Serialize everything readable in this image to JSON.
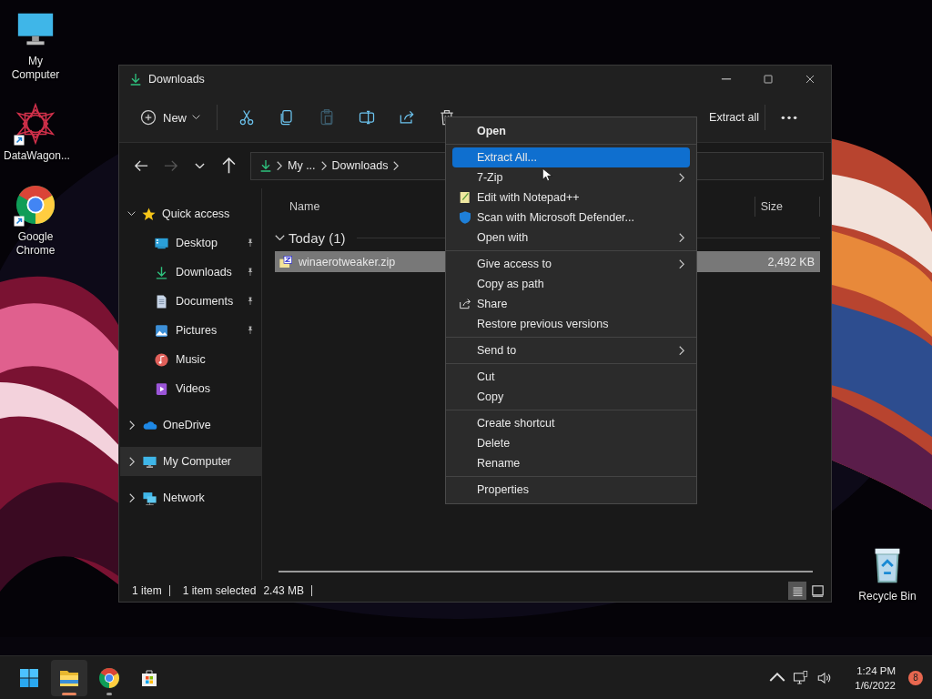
{
  "desktop": {
    "icons": [
      {
        "label": "My Computer",
        "kind": "monitor",
        "shortcut": false
      },
      {
        "label": "DataWagon...",
        "kind": "mandala",
        "shortcut": true
      },
      {
        "label": "Google Chrome",
        "kind": "chrome",
        "shortcut": true
      }
    ],
    "corner_icon": {
      "label": "Recycle Bin",
      "kind": "bin",
      "shortcut": false
    }
  },
  "window": {
    "title": "Downloads",
    "toolbar": {
      "new_label": "New",
      "actions": [
        {
          "kind": "cut",
          "disabled": false
        },
        {
          "kind": "copy",
          "disabled": false
        },
        {
          "kind": "paste",
          "disabled": true
        },
        {
          "kind": "rename",
          "disabled": false
        },
        {
          "kind": "share",
          "disabled": false
        },
        {
          "kind": "delete",
          "disabled": false
        }
      ],
      "extract_label": "Extract all"
    },
    "nav": [
      {
        "kind": "back",
        "disabled": false
      },
      {
        "kind": "forward",
        "disabled": true
      },
      {
        "kind": "recent",
        "disabled": false
      },
      {
        "kind": "up",
        "disabled": false
      }
    ],
    "address": [
      "My ...",
      "Downloads"
    ],
    "sidebar": [
      {
        "label": "Quick access",
        "kind": "star",
        "expanded": true,
        "selected": false,
        "children": [
          {
            "label": "Desktop",
            "kind": "desktop",
            "pinned": true,
            "selected": false
          },
          {
            "label": "Downloads",
            "kind": "download",
            "pinned": true,
            "selected": false
          },
          {
            "label": "Documents",
            "kind": "documents",
            "pinned": true,
            "selected": false
          },
          {
            "label": "Pictures",
            "kind": "pictures",
            "pinned": true,
            "selected": false
          },
          {
            "label": "Music",
            "kind": "music",
            "pinned": false,
            "selected": false
          },
          {
            "label": "Videos",
            "kind": "videos",
            "pinned": false,
            "selected": false
          }
        ]
      },
      {
        "label": "OneDrive",
        "kind": "cloud",
        "expanded": false,
        "selected": false
      },
      {
        "label": "My Computer",
        "kind": "computer",
        "expanded": false,
        "selected": true
      },
      {
        "label": "Network",
        "kind": "network",
        "expanded": false,
        "selected": false
      }
    ],
    "columns": [
      "Name",
      "Size"
    ],
    "group": {
      "label": "Today (1)",
      "expanded": true
    },
    "files": [
      {
        "name": "winaerotweaker.zip",
        "size": "2,492 KB",
        "selected": true
      }
    ],
    "status": [
      {
        "text": "1 item",
        "divider": true
      },
      {
        "text": "1 item selected",
        "divider": false
      },
      {
        "text": "2.43 MB",
        "divider": true
      }
    ],
    "views": [
      {
        "kind": "details",
        "selected": true
      },
      {
        "kind": "tiles",
        "selected": false
      }
    ]
  },
  "context_menu": {
    "groups": [
      [
        {
          "label": "Open",
          "default": true,
          "selected": false,
          "submenu": false
        }
      ],
      [
        {
          "label": "Extract All...",
          "default": false,
          "selected": true,
          "submenu": false
        },
        {
          "label": "7-Zip",
          "default": false,
          "selected": false,
          "submenu": true
        },
        {
          "label": "Edit with Notepad++",
          "default": false,
          "selected": false,
          "submenu": false,
          "kind": "notepad"
        },
        {
          "label": "Scan with Microsoft Defender...",
          "default": false,
          "selected": false,
          "submenu": false,
          "kind": "shield"
        },
        {
          "label": "Open with",
          "default": false,
          "selected": false,
          "submenu": true
        }
      ],
      [
        {
          "label": "Give access to",
          "default": false,
          "selected": false,
          "submenu": true
        },
        {
          "label": "Copy as path",
          "default": false,
          "selected": false,
          "submenu": false
        },
        {
          "label": "Share",
          "default": false,
          "selected": false,
          "submenu": false,
          "kind": "share"
        },
        {
          "label": "Restore previous versions",
          "default": false,
          "selected": false,
          "submenu": false
        }
      ],
      [
        {
          "label": "Send to",
          "default": false,
          "selected": false,
          "submenu": true
        }
      ],
      [
        {
          "label": "Cut",
          "default": false,
          "selected": false,
          "submenu": false
        },
        {
          "label": "Copy",
          "default": false,
          "selected": false,
          "submenu": false
        }
      ],
      [
        {
          "label": "Create shortcut",
          "default": false,
          "selected": false,
          "submenu": false
        },
        {
          "label": "Delete",
          "default": false,
          "selected": false,
          "submenu": false
        },
        {
          "label": "Rename",
          "default": false,
          "selected": false,
          "submenu": false
        }
      ],
      [
        {
          "label": "Properties",
          "default": false,
          "selected": false,
          "submenu": false
        }
      ]
    ]
  },
  "taskbar": {
    "apps": [
      {
        "kind": "windows",
        "running": false,
        "active": false
      },
      {
        "kind": "folder",
        "running": true,
        "active": true
      },
      {
        "kind": "chrome",
        "running": true,
        "active": false
      },
      {
        "kind": "store",
        "running": false,
        "active": false
      }
    ],
    "time": "1:24 PM",
    "date": "1/6/2022",
    "badge": "8"
  }
}
